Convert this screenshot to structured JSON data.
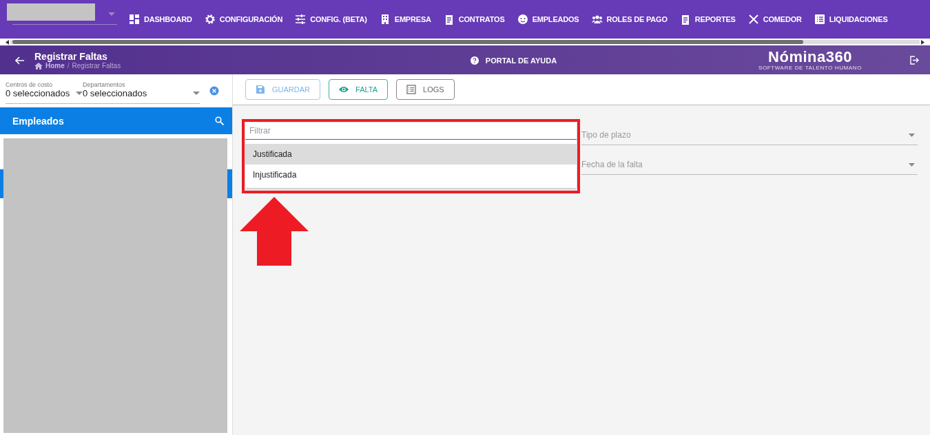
{
  "nav": {
    "items": [
      {
        "label": "DASHBOARD"
      },
      {
        "label": "CONFIGURACIÓN"
      },
      {
        "label": "CONFIG. (BETA)"
      },
      {
        "label": "EMPRESA"
      },
      {
        "label": "CONTRATOS"
      },
      {
        "label": "EMPLEADOS"
      },
      {
        "label": "ROLES DE PAGO"
      },
      {
        "label": "REPORTES"
      },
      {
        "label": "COMEDOR"
      },
      {
        "label": "LIQUIDACIONES"
      }
    ]
  },
  "header": {
    "title": "Registrar Faltas",
    "breadcrumb": [
      "Home",
      "Registrar Faltas"
    ],
    "breadcrumb_separator": "/",
    "help": "PORTAL DE AYUDA",
    "logo": {
      "name": "Nómina360",
      "tagline": "SOFTWARE DE TALENTO HUMANO"
    }
  },
  "sidebar": {
    "filters": [
      {
        "label": "Centros de costo",
        "value": "0 seleccionados"
      },
      {
        "label": "Departamentos",
        "value": "0 seleccionados"
      }
    ],
    "title": "Empleados"
  },
  "toolbar": {
    "buttons": [
      {
        "label": "GUARDAR",
        "kind": "save",
        "disabled": true
      },
      {
        "label": "FALTA",
        "kind": "view",
        "disabled": false
      },
      {
        "label": "LOGS",
        "kind": "log",
        "disabled": false
      }
    ]
  },
  "dropdown": {
    "placeholder": "Filtrar",
    "options": [
      {
        "label": "Justificada",
        "selected": true
      },
      {
        "label": "Injustificada",
        "selected": false
      }
    ]
  },
  "fields": [
    {
      "placeholder": "Tipo de plazo"
    },
    {
      "placeholder": "Fecha de la falta"
    }
  ]
}
